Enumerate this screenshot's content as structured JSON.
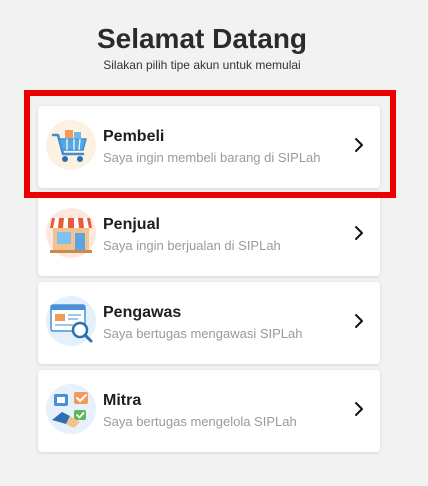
{
  "header": {
    "title": "Selamat Datang",
    "subtitle": "Silakan pilih tipe akun untuk memulai"
  },
  "cards": [
    {
      "label": "Pembeli",
      "desc": "Saya ingin membeli barang di SIPLah",
      "icon": "shopping-cart-icon"
    },
    {
      "label": "Penjual",
      "desc": "Saya ingin berjualan di SIPLah",
      "icon": "storefront-icon"
    },
    {
      "label": "Pengawas",
      "desc": "Saya bertugas mengawasi SIPLah",
      "icon": "inspection-magnifier-icon"
    },
    {
      "label": "Mitra",
      "desc": "Saya bertugas mengelola SIPLah",
      "icon": "partner-handshake-icon"
    }
  ],
  "colors": {
    "highlight": "#ee0000",
    "background": "#f2f2f2",
    "card": "#ffffff"
  }
}
